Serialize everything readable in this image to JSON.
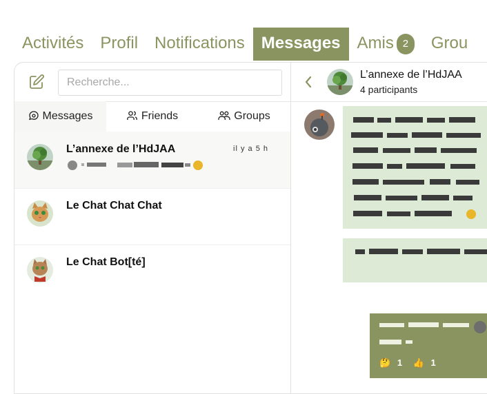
{
  "nav": {
    "tabs": [
      "Activités",
      "Profil",
      "Notifications",
      "Messages",
      "Amis",
      "Grou"
    ],
    "active_tab": "Messages",
    "amis_badge": "2"
  },
  "sidebar": {
    "search_placeholder": "Recherche...",
    "subtabs": [
      "Messages",
      "Friends",
      "Groups"
    ]
  },
  "conversations": [
    {
      "name": "L’annexe de l’HdJAA",
      "time": "il y a 5 h",
      "has_preview": true
    },
    {
      "name": "Le Chat Chat Chat"
    },
    {
      "name": "Le Chat Bot[té]"
    }
  ],
  "chat": {
    "title": "L’annexe de l’HdJAA",
    "participants": "4 participants",
    "reactions": [
      {
        "emoji": "🤔",
        "count": "1"
      },
      {
        "emoji": "👍",
        "count": "1"
      }
    ]
  },
  "colors": {
    "accent": "#8a9460",
    "bubble_in": "#ddebd6",
    "bubble_out": "#8a9460"
  }
}
